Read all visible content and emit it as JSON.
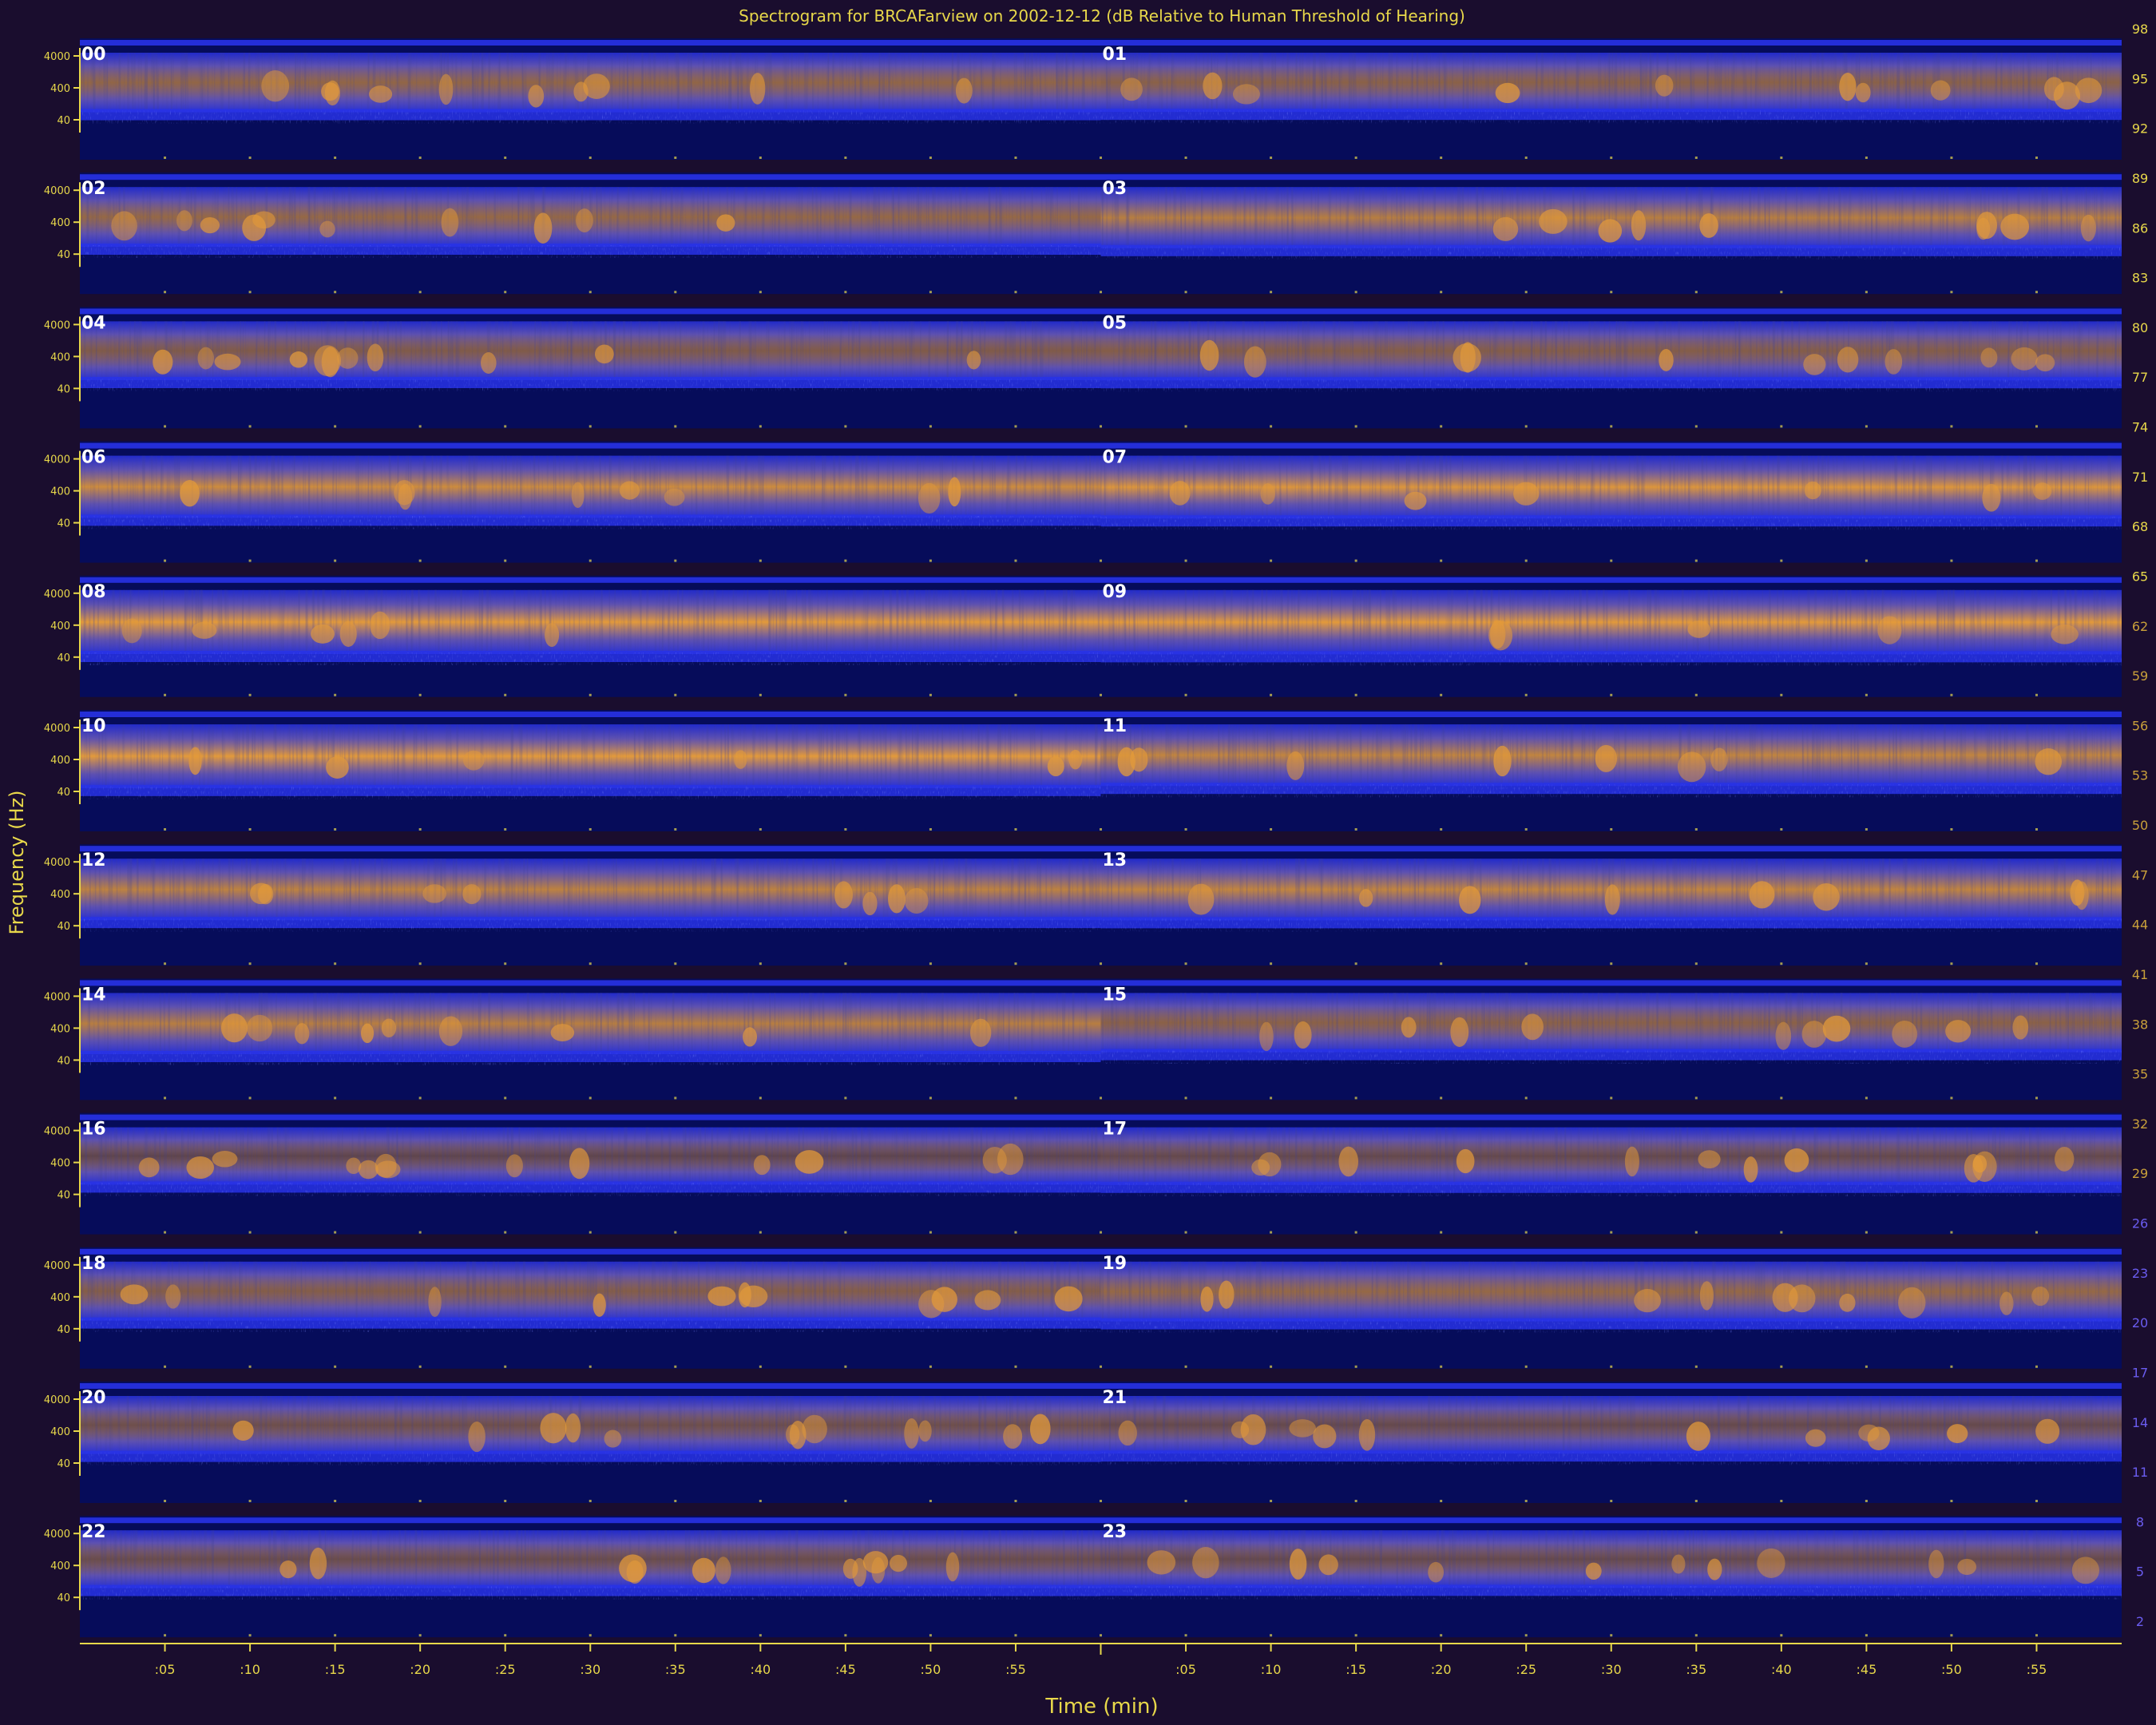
{
  "chart_data": {
    "type": "heatmap",
    "title": "Spectrogram for BRCAFarview on 2002-12-12 (dB Relative to Human Threshold of Hearing)",
    "xlabel": "Time (min)",
    "ylabel": "Frequency (Hz)",
    "hours": [
      "00",
      "01",
      "02",
      "03",
      "04",
      "05",
      "06",
      "07",
      "08",
      "09",
      "10",
      "11",
      "12",
      "13",
      "14",
      "15",
      "16",
      "17",
      "18",
      "19",
      "20",
      "21",
      "22",
      "23"
    ],
    "x_tick_labels": [
      ":05",
      ":10",
      ":15",
      ":20",
      ":25",
      ":30",
      ":35",
      ":40",
      ":45",
      ":50",
      ":55"
    ],
    "y_tick_labels": [
      "4000",
      "400",
      "40"
    ],
    "colorbar_ticks": [
      98,
      95,
      92,
      89,
      86,
      83,
      80,
      77,
      74,
      71,
      68,
      65,
      62,
      59,
      56,
      53,
      50,
      47,
      44,
      41,
      38,
      35,
      32,
      29,
      26,
      23,
      20,
      17,
      14,
      11,
      8,
      5,
      2
    ],
    "band_intensity": [
      0.38,
      0.35,
      0.4,
      0.55,
      0.3,
      0.32,
      0.65,
      0.72,
      0.85,
      0.88,
      0.82,
      0.6,
      0.58,
      0.6,
      0.55,
      0.35,
      0.15,
      0.18,
      0.32,
      0.4,
      0.22,
      0.18,
      0.2,
      0.18
    ],
    "colors": {
      "background": "#1a0d2e",
      "plot_dark": "#060c5a",
      "band_blue": "#2832e6",
      "band_mid": "#6d5dc0",
      "band_hot": "#e39a3a",
      "axis": "#e8d84a",
      "hour_label": "#ffffff"
    }
  }
}
